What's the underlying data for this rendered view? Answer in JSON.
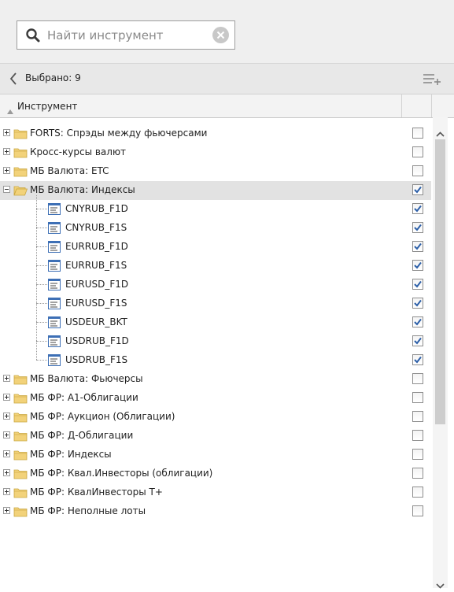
{
  "search": {
    "placeholder": "Найти инструмент"
  },
  "selected_bar": {
    "label": "Выбрано: 9"
  },
  "column_header": {
    "title": "Инструмент"
  },
  "tree": {
    "items": [
      {
        "label": "FORTS: Спрэды между фьючерсами",
        "type": "folder",
        "expanded": false,
        "checked": false
      },
      {
        "label": "Кросс-курсы валют",
        "type": "folder",
        "expanded": false,
        "checked": false
      },
      {
        "label": "МБ Валюта: ETC",
        "type": "folder",
        "expanded": false,
        "checked": false
      },
      {
        "label": "МБ Валюта: Индексы",
        "type": "folder",
        "expanded": true,
        "checked": true
      },
      {
        "label": "CNYRUB_F1D",
        "type": "instrument",
        "checked": true
      },
      {
        "label": "CNYRUB_F1S",
        "type": "instrument",
        "checked": true
      },
      {
        "label": "EURRUB_F1D",
        "type": "instrument",
        "checked": true
      },
      {
        "label": "EURRUB_F1S",
        "type": "instrument",
        "checked": true
      },
      {
        "label": "EURUSD_F1D",
        "type": "instrument",
        "checked": true
      },
      {
        "label": "EURUSD_F1S",
        "type": "instrument",
        "checked": true
      },
      {
        "label": "USDEUR_BKT",
        "type": "instrument",
        "checked": true
      },
      {
        "label": "USDRUB_F1D",
        "type": "instrument",
        "checked": true
      },
      {
        "label": "USDRUB_F1S",
        "type": "instrument",
        "checked": true
      },
      {
        "label": "МБ Валюта: Фьючерсы",
        "type": "folder",
        "expanded": false,
        "checked": false
      },
      {
        "label": "МБ ФР: А1-Облигации",
        "type": "folder",
        "expanded": false,
        "checked": false
      },
      {
        "label": "МБ ФР: Аукцион (Облигации)",
        "type": "folder",
        "expanded": false,
        "checked": false
      },
      {
        "label": "МБ ФР: Д-Облигации",
        "type": "folder",
        "expanded": false,
        "checked": false
      },
      {
        "label": "МБ ФР: Индексы",
        "type": "folder",
        "expanded": false,
        "checked": false
      },
      {
        "label": "МБ ФР: Квал.Инвесторы (облигации)",
        "type": "folder",
        "expanded": false,
        "checked": false
      },
      {
        "label": "МБ ФР: КвалИнвесторы Т+",
        "type": "folder",
        "expanded": false,
        "checked": false
      },
      {
        "label": "МБ ФР: Неполные лоты",
        "type": "folder",
        "expanded": false,
        "checked": false
      }
    ]
  },
  "colors": {
    "folder": "#f2d27a",
    "folder_edge": "#c9a640",
    "doc_accent": "#3d6fb5",
    "check": "#2c5fa8",
    "expanded_row_bg": "#e2e2e2"
  },
  "icons": {
    "search": "magnifier-icon",
    "clear": "clear-circle-icon",
    "back": "chevron-left-icon",
    "list_add": "list-add-icon",
    "sort": "sort-up-icon",
    "folder": "folder-icon",
    "instrument": "instrument-doc-icon",
    "scroll_up": "chevron-up-icon",
    "scroll_down": "chevron-down-icon"
  }
}
